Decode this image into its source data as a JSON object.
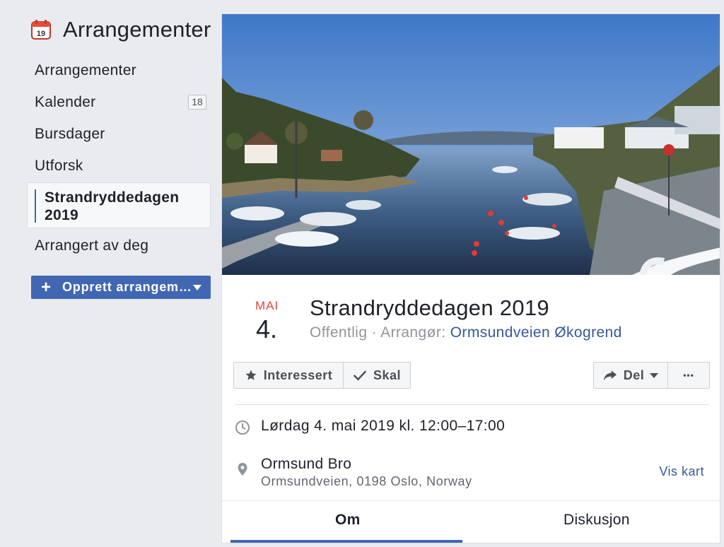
{
  "sidebar": {
    "title": "Arrangementer",
    "calendar_icon_number": "19",
    "items": [
      {
        "label": "Arrangementer"
      },
      {
        "label": "Kalender",
        "badge": "18"
      },
      {
        "label": "Bursdager"
      },
      {
        "label": "Utforsk"
      },
      {
        "label": "Strandryddedagen 2019",
        "active": true
      },
      {
        "label": "Arrangert av deg"
      }
    ],
    "create_button": {
      "label": "Opprett arrangem…",
      "icon": "plus-icon"
    }
  },
  "event": {
    "date_month": "MAI",
    "date_day": "4.",
    "title": "Strandryddedagen 2019",
    "privacy": "Offentlig",
    "separator": " · ",
    "host_label": "Arrangør: ",
    "host_name": "Ormsundveien Økogrend",
    "actions": {
      "interested": "Interessert",
      "going": "Skal",
      "share": "Del",
      "more": "•••"
    },
    "time": "Lørdag 4. mai 2019 kl. 12:00–17:00",
    "location": {
      "name": "Ormsund Bro",
      "address": "Ormsundveien, 0198 Oslo, Norway",
      "map_link": "Vis kart"
    },
    "tabs": [
      {
        "label": "Om",
        "active": true
      },
      {
        "label": "Diskusjon",
        "active": false
      }
    ]
  },
  "colors": {
    "accent": "#4267b2",
    "link": "#365899",
    "date_month": "#d94a3d",
    "background": "#e9ebee"
  }
}
